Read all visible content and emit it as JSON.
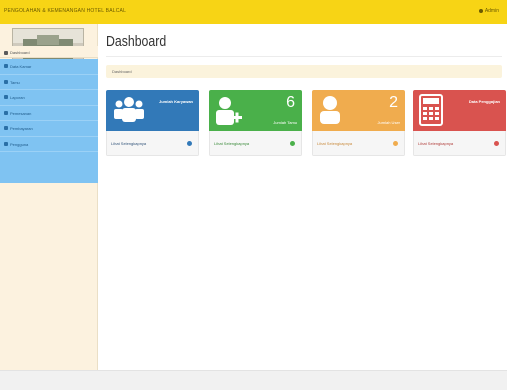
{
  "header": {
    "brand": "PENGOLAHAN & KEMENANGAN HOTEL BALCAL",
    "user_label": "Admin"
  },
  "sidebar": {
    "dashboard_label": "Dashboard",
    "items": [
      {
        "label": "Data Kamar",
        "icon": "bed-icon"
      },
      {
        "label": "Tamu",
        "icon": "user-icon"
      },
      {
        "label": "Laporan",
        "icon": "file-icon"
      },
      {
        "label": "Pemesanan",
        "icon": "cart-icon"
      },
      {
        "label": "Pembayaran",
        "icon": "money-icon"
      },
      {
        "label": "Pengguna",
        "icon": "users-icon"
      }
    ]
  },
  "main": {
    "title": "Dashboard",
    "breadcrumb": "Dashboard"
  },
  "cards": [
    {
      "value": "",
      "small": "",
      "header_text": "Jumlah Karyawan",
      "footer": "Lihat Selengkapnya",
      "color": "#3279b8",
      "icon": "users-group-icon"
    },
    {
      "value": "6",
      "small": "Jumlah Tamu",
      "header_text": "",
      "footer": "Lihat Selengkapnya",
      "color": "#4ab04a",
      "icon": "user-add-icon"
    },
    {
      "value": "2",
      "small": "Jumlah User",
      "header_text": "",
      "footer": "Lihat Selengkapnya",
      "color": "#f0ac4e",
      "icon": "user-icon"
    },
    {
      "value": "",
      "small": "",
      "header_text": "Data Penggajian",
      "footer": "Lihat Selengkapnya",
      "color": "#d9534f",
      "icon": "calculator-icon"
    }
  ]
}
